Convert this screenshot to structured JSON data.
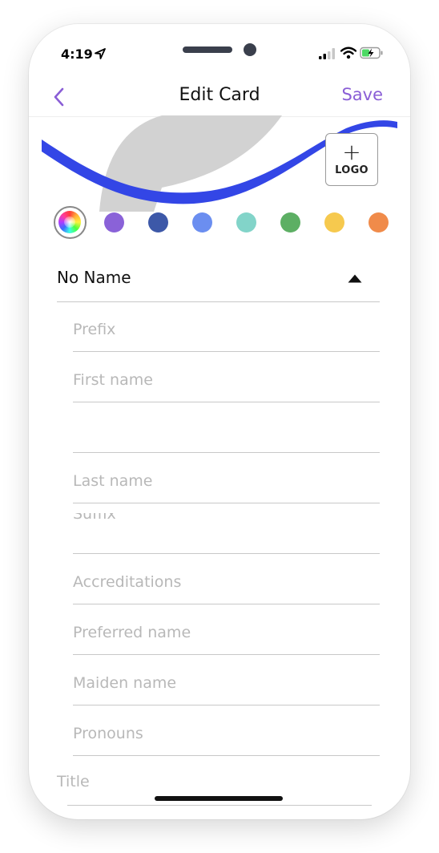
{
  "status_bar": {
    "time": "4:19"
  },
  "nav": {
    "title": "Edit Card",
    "save_label": "Save"
  },
  "logo_button": {
    "plus": "+",
    "label": "LOGO"
  },
  "colors": {
    "accent": "#8a5ed6",
    "banner_wave": "#3346e6",
    "swatches": [
      "#8a62d8",
      "#3d58a8",
      "#6b8ef0",
      "#82d4c9",
      "#5daf64",
      "#f6c94e",
      "#f08b4a"
    ]
  },
  "section": {
    "title": "No Name",
    "expanded": true
  },
  "fields": [
    {
      "placeholder": "Prefix",
      "value": ""
    },
    {
      "placeholder": "First name",
      "value": ""
    },
    {
      "placeholder": "",
      "value": ""
    },
    {
      "placeholder": "Last name",
      "value": ""
    },
    {
      "placeholder": "Suffix",
      "value": ""
    },
    {
      "placeholder": "Accreditations",
      "value": ""
    },
    {
      "placeholder": "Preferred name",
      "value": ""
    },
    {
      "placeholder": "Maiden name",
      "value": ""
    },
    {
      "placeholder": "Pronouns",
      "value": ""
    }
  ],
  "title_field": {
    "placeholder": "Title"
  }
}
